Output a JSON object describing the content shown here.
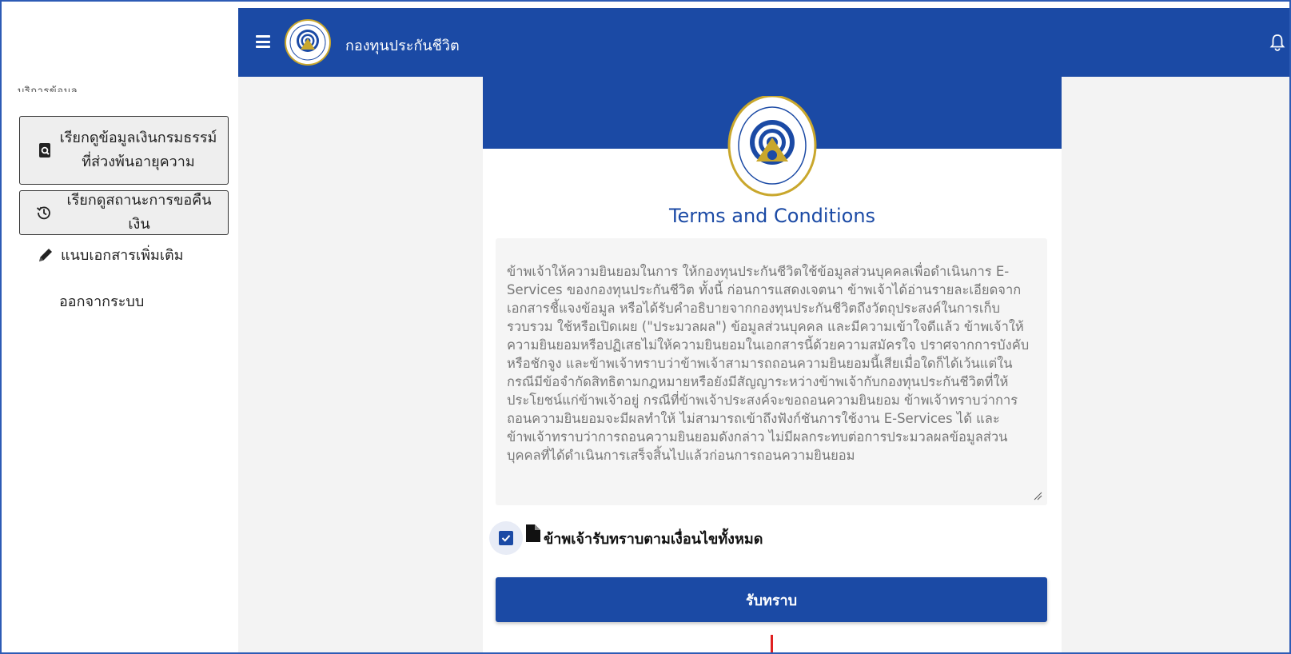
{
  "app": {
    "title": "กองทุนประกันชีวิต"
  },
  "sidebar": {
    "cut_text": "บริการข้อมูล",
    "items": [
      {
        "label": "เรียกดูข้อมูลเงินกรมธรรม์ ที่ส่วงพ้นอายุความ",
        "icon": "search-document-icon"
      },
      {
        "label": "เรียกดูสถานะการขอคืนเงิน",
        "icon": "history-icon"
      },
      {
        "label": "แนบเอกสารเพิ่มเติม",
        "icon": "pencil-icon"
      },
      {
        "label": "ออกจากระบบ",
        "icon": ""
      }
    ]
  },
  "card": {
    "title": "Terms and Conditions",
    "terms_text": "ข้าพเจ้าให้ความยินยอมในการ ให้กองทุนประกันชีวิตใช้ข้อมูลส่วนบุคคลเพื่อดำเนินการ E-Services ของกองทุนประกันชีวิต ทั้งนี้ ก่อนการแสดงเจตนา ข้าพเจ้าได้อ่านรายละเอียดจากเอกสารชี้แจงข้อมูล หรือได้รับคำอธิบายจากกองทุนประกันชีวิตถึงวัตถุประสงค์ในการเก็บรวบรวม ใช้หรือเปิดเผย (\"ประมวลผล\") ข้อมูลส่วนบุคคล และมีความเข้าใจดีแล้ว ข้าพเจ้าให้ความยินยอมหรือปฏิเสธไม่ให้ความยินยอมในเอกสารนี้ด้วยความสมัครใจ ปราศจากการบังคับหรือชักจูง และข้าพเจ้าทราบว่าข้าพเจ้าสามารถถอนความยินยอมนี้เสียเมื่อใดก็ได้เว้นแต่ในกรณีมีข้อจำกัดสิทธิตามกฎหมายหรือยังมีสัญญาระหว่างข้าพเจ้ากับกองทุนประกันชีวิตที่ให้ประโยชน์แก่ข้าพเจ้าอยู่ กรณีที่ข้าพเจ้าประสงค์จะขอถอนความยินยอม ข้าพเจ้าทราบว่าการถอนความยินยอมจะมีผลทำให้ ไม่สามารถเข้าถึงฟังก์ชันการใช้งาน E-Services ได้ และข้าพเจ้าทราบว่าการถอนความยินยอมดังกล่าว ไม่มีผลกระทบต่อการประมวลผลข้อมูลส่วนบุคคลที่ได้ดำเนินการเสร็จสิ้นไปแล้วก่อนการถอนความยินยอม",
    "agree_label": "ข้าพเจ้ารับทราบตามเงื่อนไขทั้งหมด",
    "agree_checked": true,
    "accept_label": "รับทราบ"
  },
  "colors": {
    "primary": "#1b4aa5",
    "content_bg": "#f3f3f3",
    "marker": "#e02020"
  }
}
